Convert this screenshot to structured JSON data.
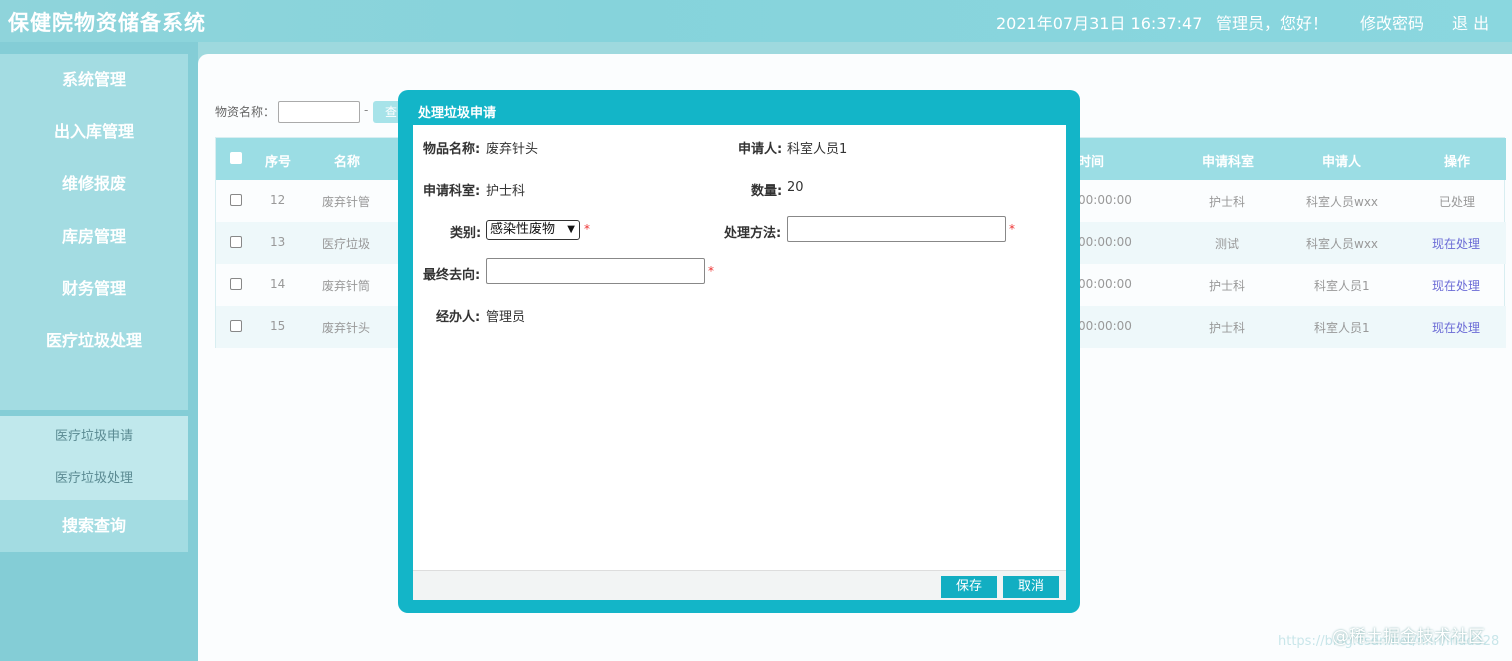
{
  "header": {
    "app_title": "保健院物资储备系统",
    "datetime": "2021年07月31日 16:37:47",
    "greeting": "管理员，您好！",
    "change_password": "修改密码",
    "logout": "退 出"
  },
  "sidebar": {
    "items": [
      {
        "label": "系统管理"
      },
      {
        "label": "出入库管理"
      },
      {
        "label": "维修报废"
      },
      {
        "label": "库房管理"
      },
      {
        "label": "财务管理"
      },
      {
        "label": "医疗垃圾处理"
      }
    ],
    "sub_items": [
      {
        "label": "医疗垃圾申请"
      },
      {
        "label": "医疗垃圾处理"
      }
    ],
    "search_item": "搜索查询"
  },
  "search": {
    "label": "物资名称：",
    "value": "",
    "dash": "-",
    "button": "查"
  },
  "table": {
    "headers": {
      "seq": "序号",
      "name": "名称",
      "time": "时间",
      "dept": "申请科室",
      "applicant": "申请人",
      "action": "操作"
    },
    "rows": [
      {
        "seq": "12",
        "name": "废弃针管",
        "time": "00:00:00",
        "dept": "护士科",
        "applicant": "科室人员wxx",
        "action": "已处理"
      },
      {
        "seq": "13",
        "name": "医疗垃圾",
        "time": "00:00:00",
        "dept": "测试",
        "applicant": "科室人员wxx",
        "action": "现在处理"
      },
      {
        "seq": "14",
        "name": "废弃针筒",
        "time": "00:00:00",
        "dept": "护士科",
        "applicant": "科室人员1",
        "action": "现在处理"
      },
      {
        "seq": "15",
        "name": "废弃针头",
        "time": "00:00:00",
        "dept": "护士科",
        "applicant": "科室人员1",
        "action": "现在处理"
      }
    ]
  },
  "modal": {
    "title": "处理垃圾申请",
    "item_name_label": "物品名称:",
    "item_name_value": "废弃针头",
    "applicant_label": "申请人:",
    "applicant_value": "科室人员1",
    "dept_label": "申请科室:",
    "dept_value": "护士科",
    "quantity_label": "数量:",
    "quantity_value": "20",
    "category_label": "类别:",
    "category_value": "感染性废物",
    "method_label": "处理方法:",
    "method_value": "",
    "destination_label": "最终去向:",
    "destination_value": "",
    "handler_label": "经办人:",
    "handler_value": "管理员",
    "required_mark": "*",
    "save": "保存",
    "cancel": "取消"
  },
  "watermark": {
    "url": "https://blog.csdn.net/nnn/lndd328",
    "brand": "@稀土掘金技术社区"
  },
  "colors": {
    "header_bg": "#86d3db",
    "modal_frame": "#13b5c8",
    "button_bg": "#12aec2",
    "action_link": "#6b6bd6",
    "required": "#e33333"
  }
}
